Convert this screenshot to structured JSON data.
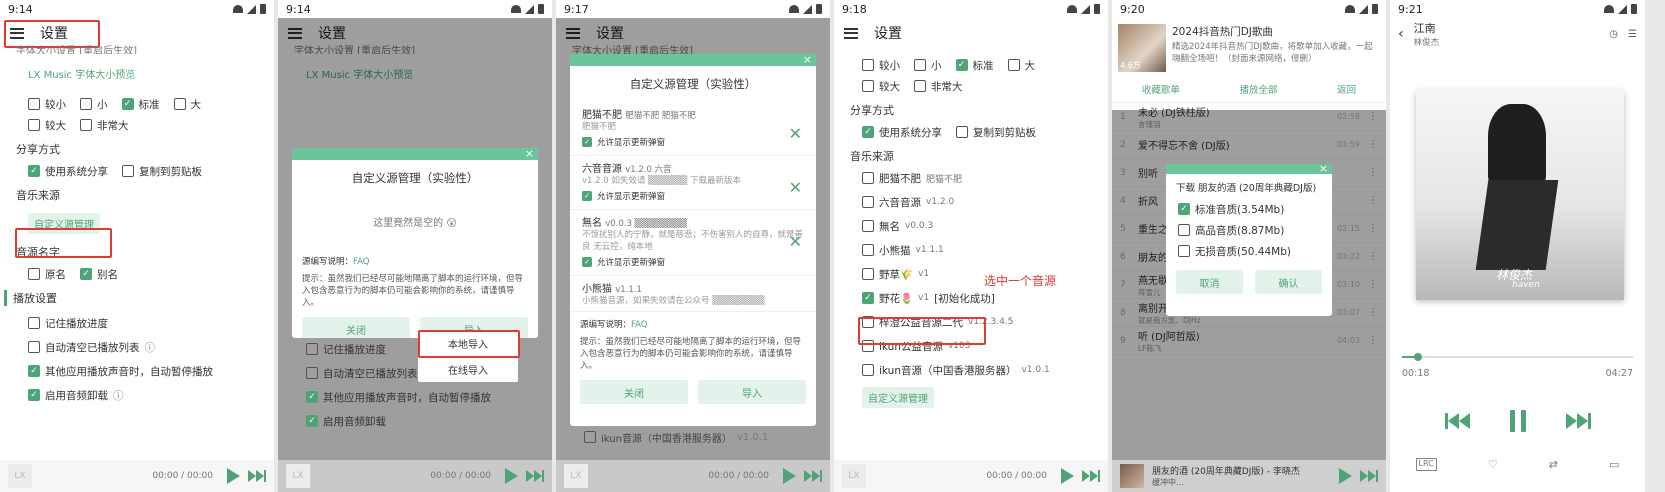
{
  "p1": {
    "time": "9:14",
    "title": "设置",
    "font_size_text": "字体大小设置 [重启后生效]",
    "preview": "LX Music 字体大小预览",
    "size_options": [
      "较小",
      "小",
      "标准",
      "大"
    ],
    "size_options2": [
      "较大",
      "非常大"
    ],
    "share_title": "分享方式",
    "share_options": [
      "使用系统分享",
      "复制到剪贴板"
    ],
    "music_source_title": "音乐来源",
    "custom_source_button": "自定义源管理",
    "source_name_title": "音源名字",
    "source_name_options": [
      "原名",
      "别名"
    ],
    "play_settings_title": "播放设置",
    "play_options": [
      "记住播放进度",
      "自动清空已播放列表",
      "其他应用播放声音时，自动暂停播放",
      "启用音频卸载"
    ],
    "player_time": "00:00 / 00:00",
    "logo": "LX"
  },
  "p2": {
    "time": "9:14",
    "title": "设置",
    "font_size_text": "字体大小设置 [重启后生效]",
    "preview": "LX Music 字体大小预览",
    "dialog_title": "自定义源管理（实验性）",
    "empty_text": "这里竟然是空的 😮",
    "doc_label": "源编写说明：",
    "doc_link": "FAQ",
    "hint": "提示：虽然我们已经尽可能地隔离了脚本的运行环境，但导入包含恶意行为的脚本仍可能会影响你的系统，请谨慎导入。",
    "close_button": "关闭",
    "import_button": "导入",
    "menu_local": "本地导入",
    "menu_online": "在线导入",
    "play_options": [
      "记住播放进度",
      "自动清空已播放列表",
      "其他应用播放声音时，自动暂停播放",
      "启用音频卸载"
    ],
    "player_time": "00:00 / 00:00",
    "logo": "LX"
  },
  "p3": {
    "time": "9:17",
    "title": "设置",
    "font_size_text": "字体大小设置 [重启后生效]",
    "dialog_title": "自定义源管理（实验性）",
    "sources": [
      {
        "name": "肥猫不肥",
        "meta": "肥猫不肥  肥猫不肥",
        "desc": "肥猫不肥",
        "allow": "允许显示更新弹窗"
      },
      {
        "name": "六音音源",
        "meta": "v1.2.0  六音",
        "desc": "v1.2.0 如失效请 ▒▒▒▒▒▒ 下载最新版本",
        "allow": "允许显示更新弹窗"
      },
      {
        "name": "無名",
        "meta": "v0.0.3 ▒▒▒▒▒▒▒▒",
        "desc": "不惊扰别人的宁静，就是慈悲；不伤害别人的自尊，就是善良 无云控，纯本地",
        "allow": "允许显示更新弹窗"
      },
      {
        "name": "小熊猫",
        "meta": "v1.1.1",
        "desc": "小熊猫音源，如果失效请在公众号 ▒▒▒▒▒▒▒▒"
      }
    ],
    "doc_label": "源编写说明：",
    "doc_link": "FAQ",
    "hint": "提示：虽然我们已经尽可能地隔离了脚本的运行环境，但导入包含恶意行为的脚本仍可能会影响你的系统，请谨慎导入。",
    "close_button": "关闭",
    "import_button": "导入",
    "bottom_item": "ikun音源（中国香港服务器）",
    "bottom_item_ver": "v1.0.1",
    "player_time": "00:00 / 00:00",
    "logo": "LX"
  },
  "p4": {
    "time": "9:18",
    "title": "设置",
    "size_options": [
      "较小",
      "小",
      "标准",
      "大"
    ],
    "size_options2": [
      "较大",
      "非常大"
    ],
    "share_title": "分享方式",
    "share_options": [
      "使用系统分享",
      "复制到剪贴板"
    ],
    "music_source_title": "音乐来源",
    "sources": [
      {
        "name": "肥猫不肥",
        "ver": "肥猫不肥"
      },
      {
        "name": "六音音源",
        "ver": "v1.2.0"
      },
      {
        "name": "無名",
        "ver": "v0.0.3"
      },
      {
        "name": "小熊猫",
        "ver": "v1.1.1"
      },
      {
        "name": "野草🌾",
        "ver": "v1"
      },
      {
        "name": "野花🌷",
        "ver": "v1",
        "status": "[初始化成功]"
      },
      {
        "name": "梓澄公益音源二代",
        "ver": "v1.2.3.4.5"
      },
      {
        "name": "ikun公益音源",
        "ver": "v103"
      },
      {
        "name": "ikun音源（中国香港服务器）",
        "ver": "v1.0.1"
      }
    ],
    "annotation": "选中一个音源",
    "custom_source_button": "自定义源管理",
    "player_time": "00:00 / 00:00",
    "logo": "LX"
  },
  "p5": {
    "time": "9:20",
    "playlist_title": "2024抖音热门DJ歌曲",
    "playlist_desc": "精选2024年抖音热门DJ歌曲，将歌单加入收藏，一起嗨翻全场吧！（封面来源网络，侵删）",
    "play_count": "4.6万",
    "actions": [
      "收藏歌单",
      "播放全部",
      "返回"
    ],
    "songs": [
      {
        "idx": "1",
        "name": "未必 (DJ铁柱版)",
        "artist": "言瑾羽",
        "time": "02:58"
      },
      {
        "idx": "2",
        "name": "爱不得忘不舍 (DJ版)",
        "artist": "",
        "time": "03:59"
      },
      {
        "idx": "3",
        "name": "别听",
        "artist": "",
        "time": ""
      },
      {
        "idx": "4",
        "name": "折风",
        "artist": "",
        "time": ""
      },
      {
        "idx": "5",
        "name": "重生之",
        "artist": "",
        "time": "02:15"
      },
      {
        "idx": "6",
        "name": "朋友的",
        "artist": "",
        "time": "03:22"
      },
      {
        "idx": "7",
        "name": "燕无歇 (DJ yaha)",
        "artist": "蒋雪儿",
        "time": "03:10"
      },
      {
        "idx": "8",
        "name": "离别开出花（DJ弹唱版)",
        "artist": "就是南方凯、DJHz",
        "time": "03:07"
      },
      {
        "idx": "9",
        "name": "听 (DJ阿哲版)",
        "artist": "LF陈飞",
        "time": "04:03"
      }
    ],
    "download_title": "下载 朋友的酒 (20周年典藏DJ版)",
    "qualities": [
      {
        "label": "标准音质(3.54Mb)",
        "on": true
      },
      {
        "label": "高品音质(8.87Mb)",
        "on": false
      },
      {
        "label": "无损音质(50.44Mb)",
        "on": false
      }
    ],
    "cancel": "取消",
    "confirm": "确认",
    "now_playing": "朋友的酒 (20周年典藏DJ版) - 李晓杰",
    "now_status": "缓冲中..."
  },
  "p6": {
    "time": "9:21",
    "song": "江南",
    "artist": "林俊杰",
    "cover_text": "林俊杰",
    "cover_sub": "haven",
    "progress": 0.07,
    "elapsed": "00:18",
    "total": "04:27",
    "lrc": "LRC"
  }
}
